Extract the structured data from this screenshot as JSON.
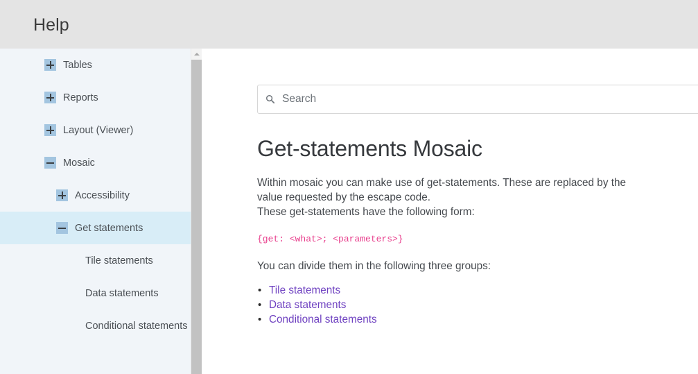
{
  "header": {
    "title": "Help"
  },
  "sidebar": {
    "scrollbar": {
      "up_arrow_icon": "chevron-up-icon"
    },
    "items": [
      {
        "label": "Tables",
        "toggle": "plus",
        "level": 0,
        "selected": false
      },
      {
        "label": "Reports",
        "toggle": "plus",
        "level": 0,
        "selected": false
      },
      {
        "label": "Layout (Viewer)",
        "toggle": "plus",
        "level": 0,
        "selected": false
      },
      {
        "label": "Mosaic",
        "toggle": "minus",
        "level": 0,
        "selected": false
      },
      {
        "label": "Accessibility",
        "toggle": "plus",
        "level": 1,
        "selected": false
      },
      {
        "label": "Get statements",
        "toggle": "minus",
        "level": 1,
        "selected": true
      },
      {
        "label": "Tile statements",
        "toggle": "none",
        "level": 2,
        "selected": false
      },
      {
        "label": "Data statements",
        "toggle": "none",
        "level": 2,
        "selected": false
      },
      {
        "label": "Conditional statements",
        "toggle": "none",
        "level": 2,
        "selected": false
      }
    ]
  },
  "search": {
    "icon": "search-icon",
    "placeholder": "Search",
    "value": ""
  },
  "article": {
    "title": "Get-statements Mosaic",
    "paragraph_1": "Within mosaic you can make use of get-statements. These are replaced by the value requested by the escape code.",
    "paragraph_2": "These get-statements have the following form:",
    "code": "{get: <what>; <parameters>}",
    "paragraph_3": "You can divide them in the following three groups:",
    "links": [
      {
        "label": "Tile statements"
      },
      {
        "label": "Data statements"
      },
      {
        "label": "Conditional statements"
      }
    ]
  },
  "colors": {
    "header_bg": "#e4e4e4",
    "sidebar_bg": "#f1f5f9",
    "selected_item_bg": "#d8edf7",
    "toggle_box": "#a3c5e0",
    "code_pink": "#e83e8c",
    "link_purple": "#6f42c1",
    "scrollbar_thumb": "#c2c2c2"
  }
}
